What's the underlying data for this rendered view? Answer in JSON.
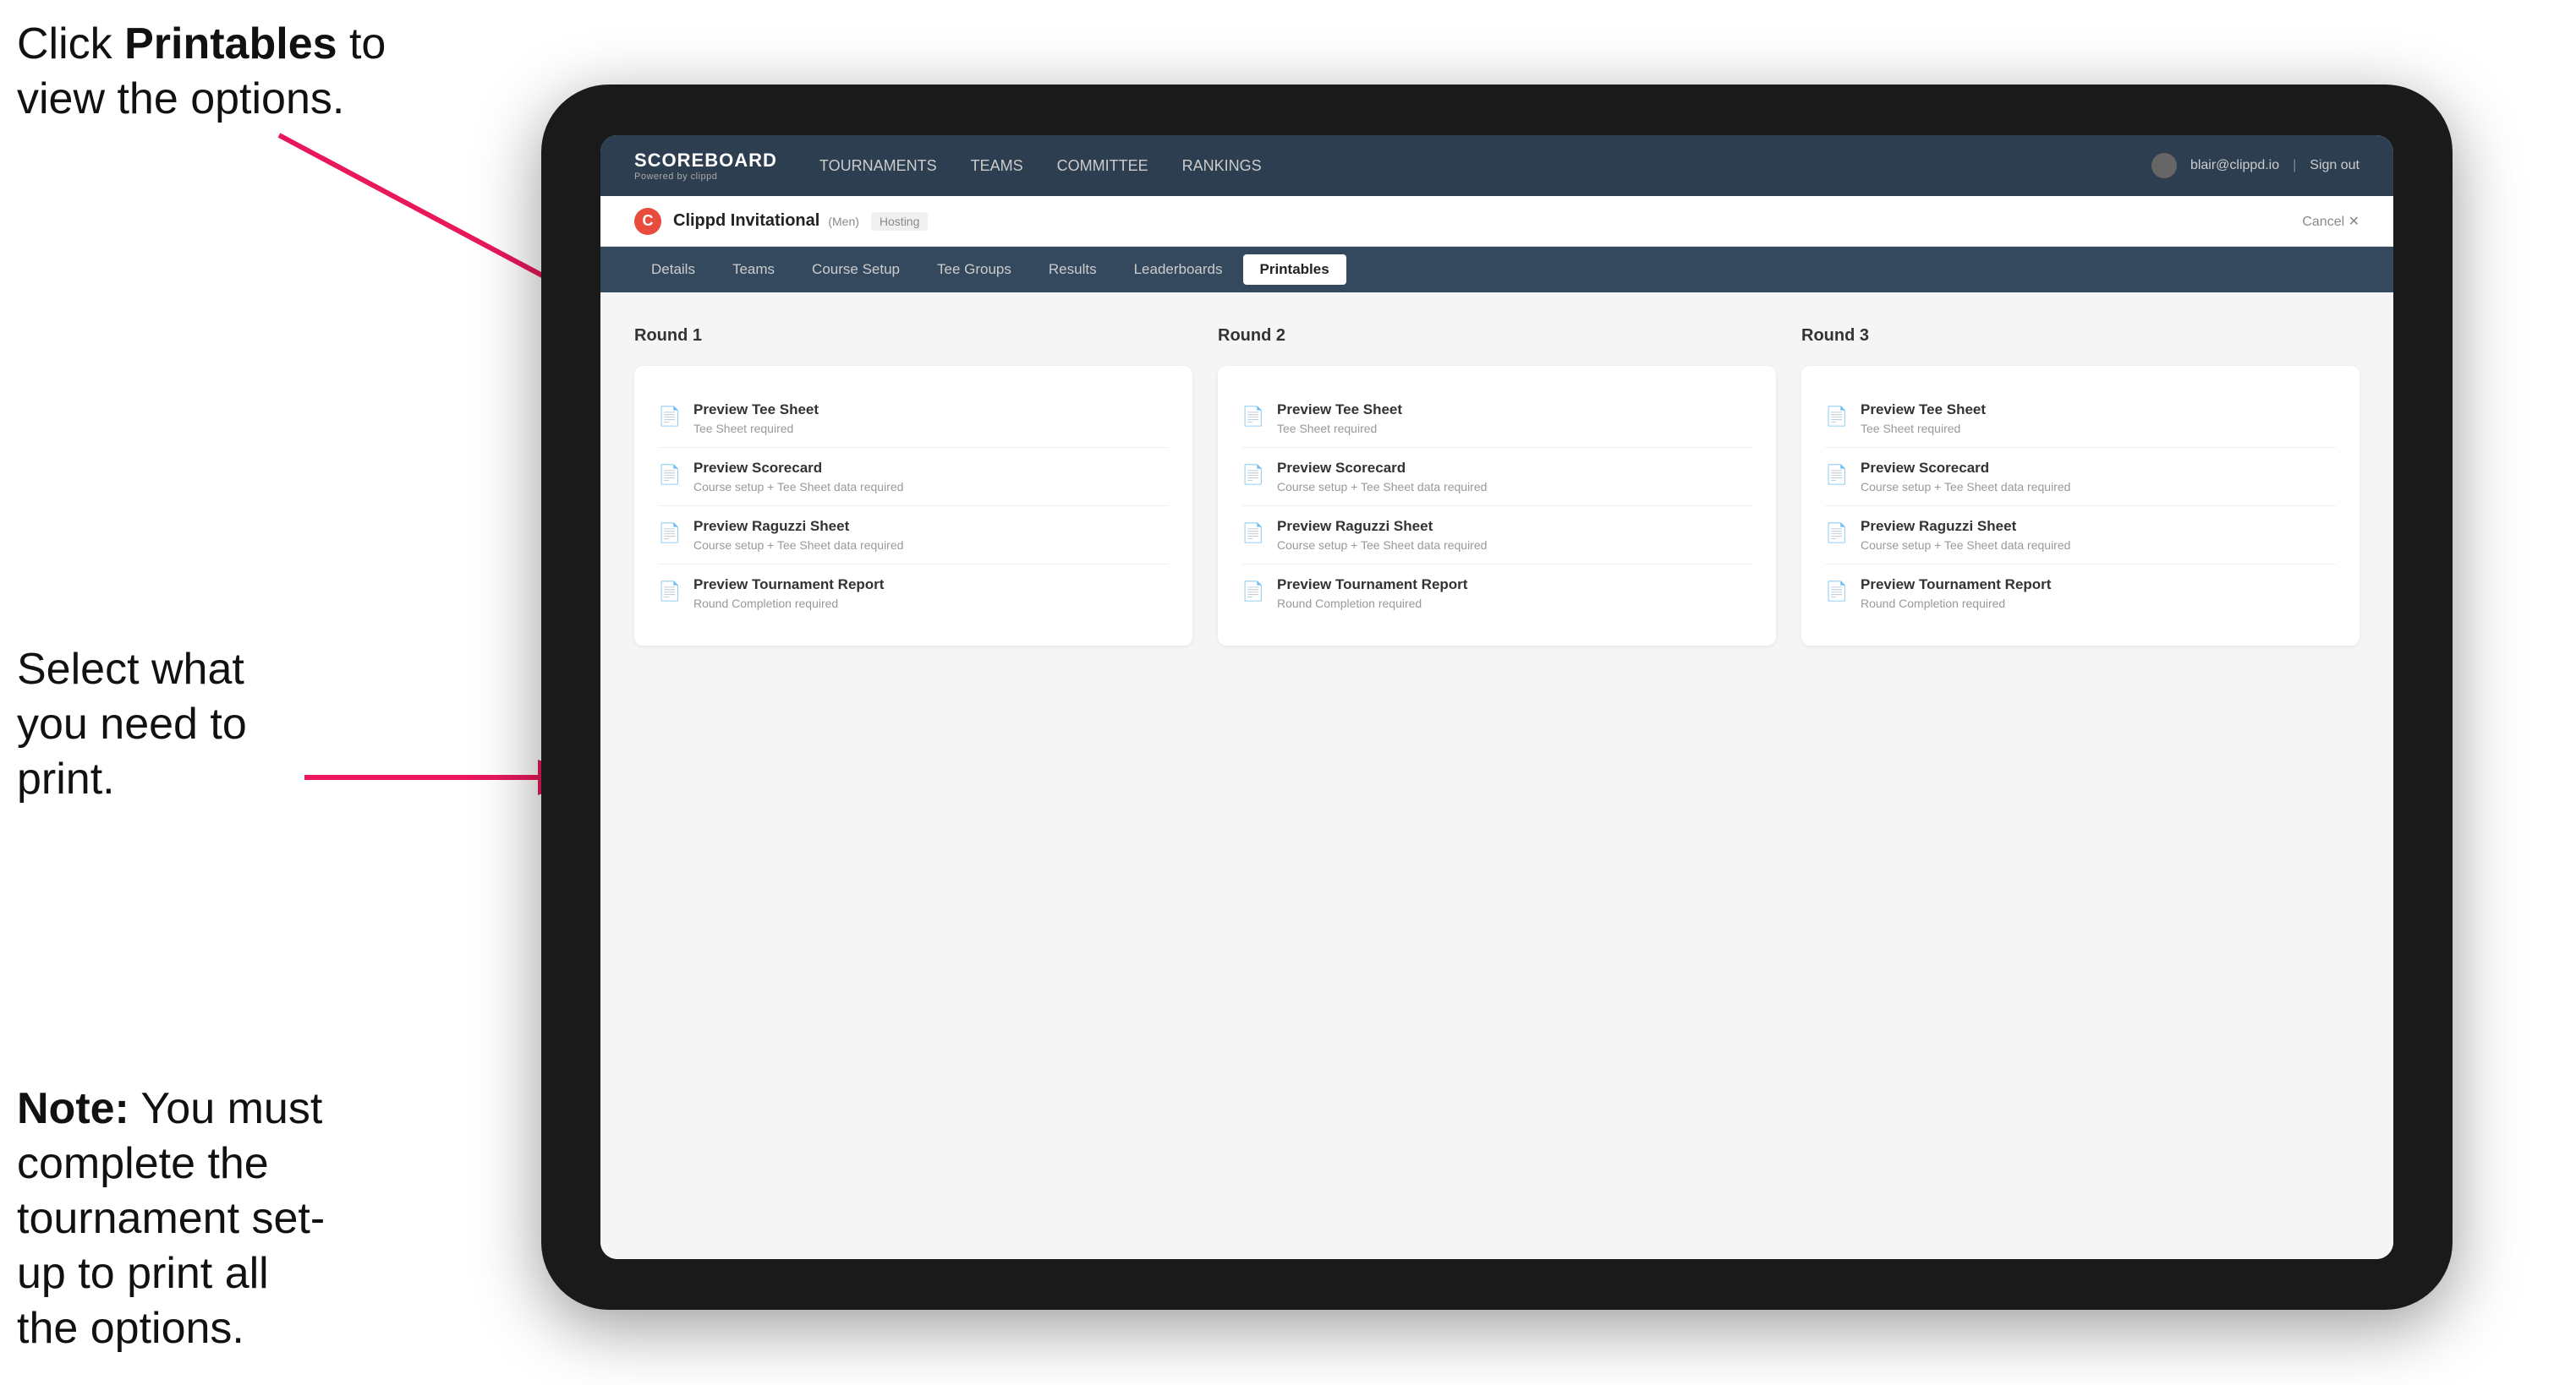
{
  "annotations": {
    "top": {
      "prefix": "Click ",
      "bold": "Printables",
      "suffix": " to\nview the options."
    },
    "middle": "Select what you need to print.",
    "bottom": {
      "bold_prefix": "Note:",
      "suffix": " You must complete the tournament set-up to print all the options."
    }
  },
  "nav": {
    "brand_name": "SCOREBOARD",
    "brand_sub": "Powered by clippd",
    "links": [
      {
        "label": "TOURNAMENTS",
        "active": false
      },
      {
        "label": "TEAMS",
        "active": false
      },
      {
        "label": "COMMITTEE",
        "active": false
      },
      {
        "label": "RANKINGS",
        "active": false
      }
    ],
    "user_email": "blair@clippd.io",
    "sign_out": "Sign out"
  },
  "sub_header": {
    "logo_letter": "C",
    "tournament_name": "Clippd Invitational",
    "tournament_tag": "(Men)",
    "status": "Hosting",
    "cancel": "Cancel ✕"
  },
  "tabs": [
    {
      "label": "Details"
    },
    {
      "label": "Teams"
    },
    {
      "label": "Course Setup"
    },
    {
      "label": "Tee Groups"
    },
    {
      "label": "Results"
    },
    {
      "label": "Leaderboards"
    },
    {
      "label": "Printables",
      "active": true
    }
  ],
  "rounds": [
    {
      "title": "Round 1",
      "items": [
        {
          "title": "Preview Tee Sheet",
          "sub": "Tee Sheet required"
        },
        {
          "title": "Preview Scorecard",
          "sub": "Course setup + Tee Sheet data required"
        },
        {
          "title": "Preview Raguzzi Sheet",
          "sub": "Course setup + Tee Sheet data required"
        },
        {
          "title": "Preview Tournament Report",
          "sub": "Round Completion required"
        }
      ]
    },
    {
      "title": "Round 2",
      "items": [
        {
          "title": "Preview Tee Sheet",
          "sub": "Tee Sheet required"
        },
        {
          "title": "Preview Scorecard",
          "sub": "Course setup + Tee Sheet data required"
        },
        {
          "title": "Preview Raguzzi Sheet",
          "sub": "Course setup + Tee Sheet data required"
        },
        {
          "title": "Preview Tournament Report",
          "sub": "Round Completion required"
        }
      ]
    },
    {
      "title": "Round 3",
      "items": [
        {
          "title": "Preview Tee Sheet",
          "sub": "Tee Sheet required"
        },
        {
          "title": "Preview Scorecard",
          "sub": "Course setup + Tee Sheet data required"
        },
        {
          "title": "Preview Raguzzi Sheet",
          "sub": "Course setup + Tee Sheet data required"
        },
        {
          "title": "Preview Tournament Report",
          "sub": "Round Completion required"
        }
      ]
    }
  ]
}
